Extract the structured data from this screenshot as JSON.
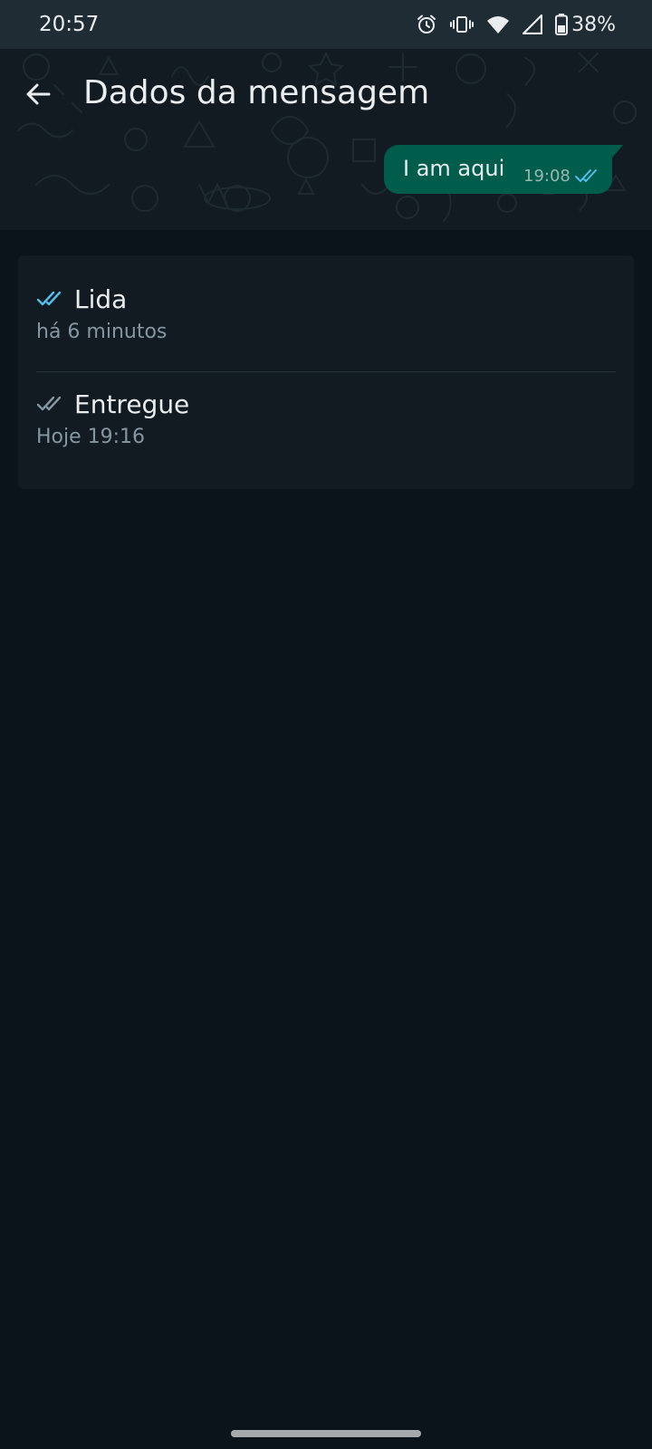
{
  "status_bar": {
    "time": "20:57",
    "battery": "38%",
    "icons": [
      "alarm-icon",
      "vibrate-icon",
      "wifi-icon",
      "signal-icon",
      "battery-icon"
    ]
  },
  "header": {
    "title": "Dados da mensagem",
    "back_icon": "arrow-left-icon"
  },
  "message": {
    "text": "I am aqui",
    "time": "19:08",
    "status_icon": "double-check-icon"
  },
  "receipts": [
    {
      "label": "Lida",
      "detail": "há 6 minutos",
      "icon": "double-check-icon",
      "icon_color": "#53bdeb"
    },
    {
      "label": "Entregue",
      "detail": "Hoje 19:16",
      "icon": "double-check-icon",
      "icon_color": "#8696a0"
    }
  ],
  "colors": {
    "background": "#0b141a",
    "header": "#111b21",
    "status_bar": "#202c33",
    "bubble": "#005c4b",
    "read_tick": "#53bdeb"
  }
}
